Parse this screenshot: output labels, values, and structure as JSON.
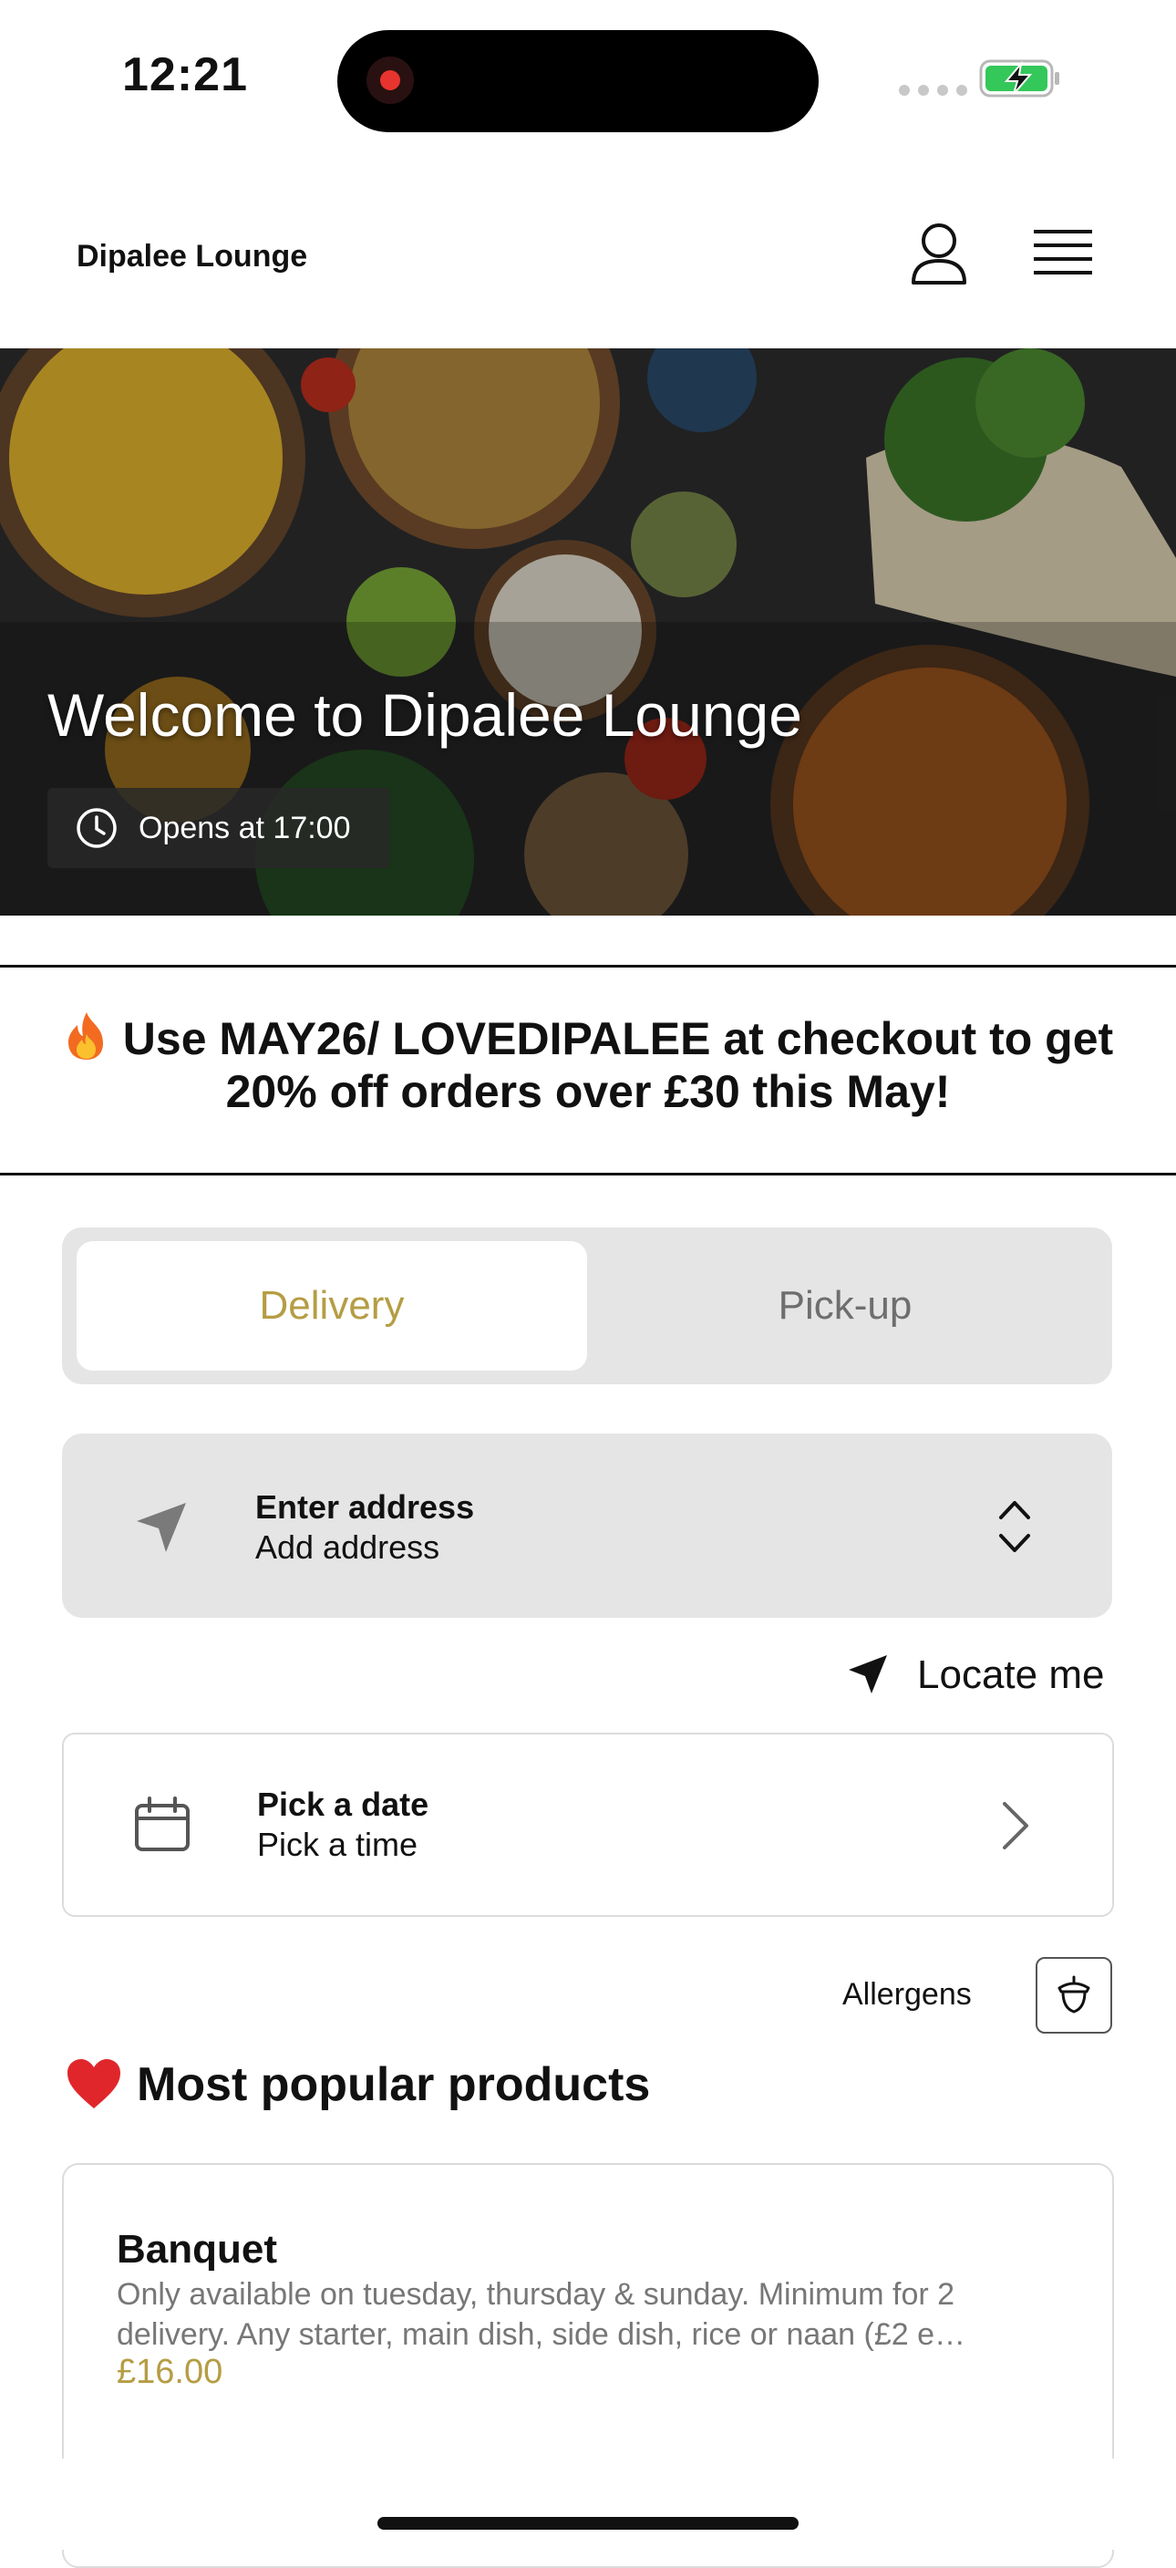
{
  "status_bar": {
    "time": "12:21"
  },
  "header": {
    "brand": "Dipalee Lounge"
  },
  "hero": {
    "title": "Welcome to Dipalee Lounge",
    "opens_text": "Opens at 17:00"
  },
  "promo": {
    "text": "Use MAY26/ LOVEDIPALEE at checkout to get 20% off orders over £30 this May!"
  },
  "order_mode": {
    "tabs": [
      {
        "label": "Delivery",
        "selected": true
      },
      {
        "label": "Pick-up",
        "selected": false
      }
    ]
  },
  "address": {
    "title": "Enter address",
    "subtitle": "Add address"
  },
  "locate": {
    "label": "Locate me"
  },
  "schedule": {
    "title": "Pick a date",
    "subtitle": "Pick a time"
  },
  "allergens": {
    "label": "Allergens"
  },
  "popular": {
    "title": "Most popular products",
    "products": [
      {
        "name": "Banquet",
        "description": "Only available on tuesday, thursday & sunday. Minimum for 2 delivery. Any starter, main dish, side dish, rice or naan (£2 e…",
        "price": "£16.00"
      }
    ]
  },
  "colors": {
    "accent_gold": "#b59d44",
    "tab_bg": "#e5e5e5",
    "battery_green": "#34c759",
    "record_red": "#e8342e"
  },
  "icons": [
    "record-icon",
    "signal-dots-icon",
    "battery-charging-icon",
    "user-icon",
    "hamburger-menu-icon",
    "clock-icon",
    "fire-emoji-icon",
    "location-arrow-icon",
    "chevron-up-down-icon",
    "calendar-icon",
    "chevron-right-icon",
    "acorn-allergen-icon",
    "heart-emoji-icon"
  ]
}
